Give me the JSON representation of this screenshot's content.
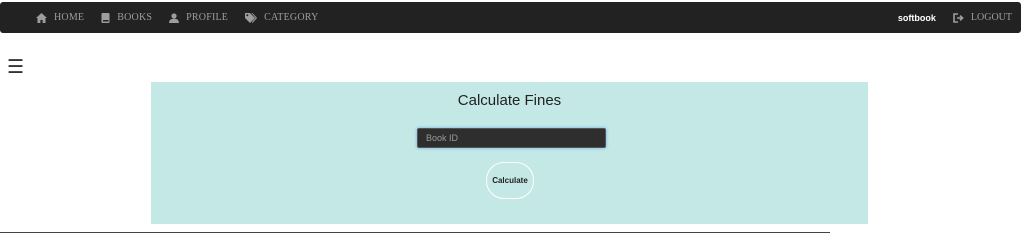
{
  "navbar": {
    "items": [
      {
        "label": "HOME",
        "icon": "home-icon"
      },
      {
        "label": "BOOKS",
        "icon": "book-icon"
      },
      {
        "label": "PROFILE",
        "icon": "user-icon"
      },
      {
        "label": "CATEGORY",
        "icon": "tag-icon"
      }
    ],
    "brand": "softbook",
    "logout_label": "LOGOUT"
  },
  "menu_icon": "hamburger-icon",
  "panel": {
    "title": "Calculate Fines",
    "book_id_placeholder": "Book ID",
    "book_id_value": "",
    "calculate_label": "Calculate"
  },
  "colors": {
    "navbar_bg": "#222222",
    "nav_text": "#9d9d9d",
    "panel_bg": "#c4e8e6"
  }
}
